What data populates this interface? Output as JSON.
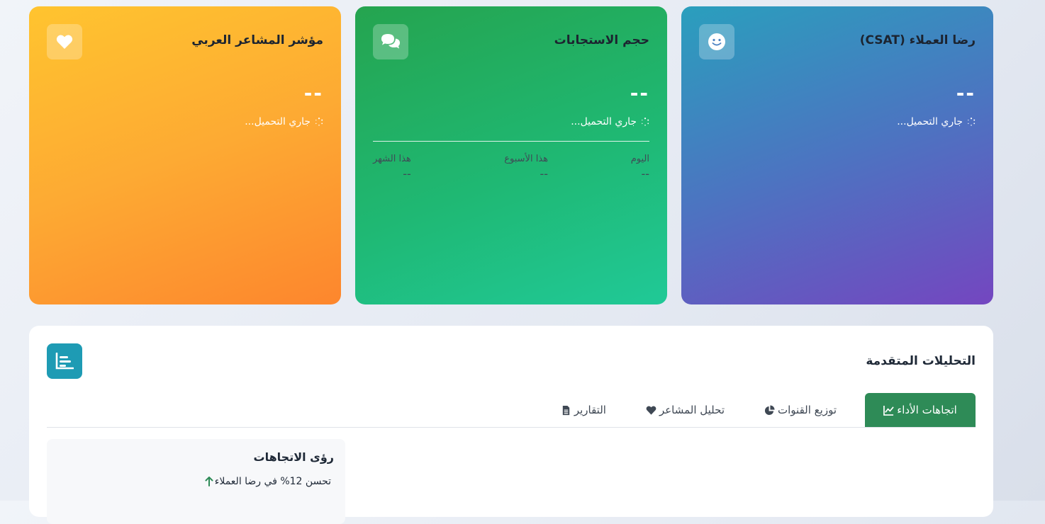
{
  "cards": {
    "csat": {
      "title": "رضا العملاء (CSAT)",
      "value": "--",
      "status": "جاري التحميل...",
      "icon": "smile-icon"
    },
    "volume": {
      "title": "حجم الاستجابات",
      "value": "--",
      "status": "جاري التحميل...",
      "icon": "comments-icon",
      "periods": [
        {
          "label": "اليوم",
          "value": "--"
        },
        {
          "label": "هذا الأسبوع",
          "value": "--"
        },
        {
          "label": "هذا الشهر",
          "value": "--"
        }
      ]
    },
    "sentiment": {
      "title": "مؤشر المشاعر العربي",
      "value": "--",
      "status": "جاري التحميل...",
      "icon": "heart-icon"
    }
  },
  "analytics": {
    "title": "التحليلات المتقدمة",
    "icon": "bar-chart-icon",
    "tabs": [
      {
        "label": "اتجاهات الأداء",
        "icon": "line-chart-icon",
        "active": true
      },
      {
        "label": "توزيع القنوات",
        "icon": "pie-chart-icon",
        "active": false
      },
      {
        "label": "تحليل المشاعر",
        "icon": "heart-icon",
        "active": false
      },
      {
        "label": "التقارير",
        "icon": "file-icon",
        "active": false
      }
    ],
    "insights": {
      "title": "رؤى الاتجاهات",
      "items": [
        {
          "text": "تحسن 12% في رضا العملاء",
          "icon": "arrow-up-icon"
        }
      ]
    }
  },
  "colors": {
    "csat_gradient": [
      "#2a9fbd",
      "#7446c0"
    ],
    "volume_gradient": [
      "#25a44f",
      "#20c997"
    ],
    "sentiment_gradient": [
      "#ffc42f",
      "#fd862d"
    ],
    "active_tab": "#2e8b57",
    "panel_icon_bg": "#1e9bb4"
  }
}
